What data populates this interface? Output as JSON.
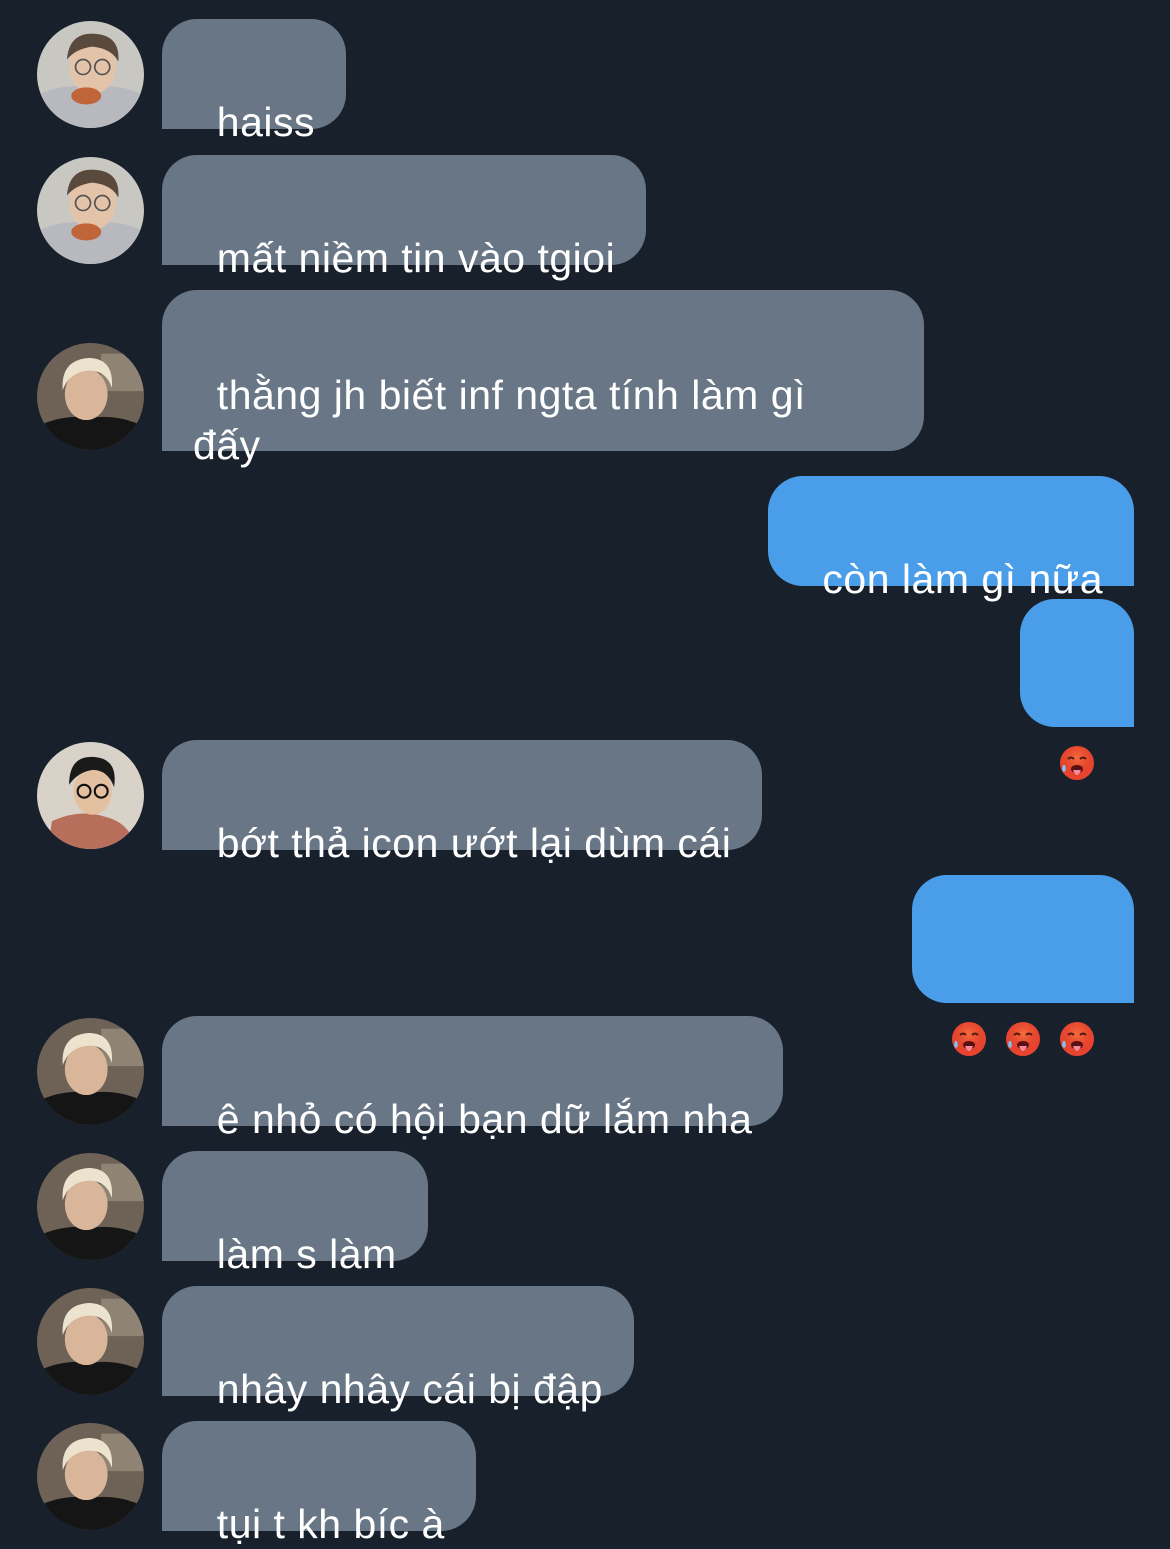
{
  "messages": [
    {
      "side": "in",
      "avatar": "glasses-boy-avatar",
      "text": "haiss"
    },
    {
      "side": "in",
      "avatar": "glasses-boy-avatar",
      "text": "mất niềm tin vào tgioi"
    },
    {
      "side": "in",
      "avatar": "blond-boy-avatar",
      "text": "thằng jh biết inf ngta tính làm gì\nđấy"
    },
    {
      "side": "out",
      "text": "còn làm gì nữa"
    },
    {
      "side": "out",
      "emoji": [
        "hot-face-emoji"
      ]
    },
    {
      "side": "in",
      "avatar": "dark-hair-boy-avatar",
      "text": "bớt thả icon ướt lại dùm cái"
    },
    {
      "side": "out",
      "emoji": [
        "hot-face-emoji",
        "hot-face-emoji",
        "hot-face-emoji"
      ]
    },
    {
      "side": "in",
      "avatar": "blond-boy-avatar",
      "text": "ê nhỏ có hội bạn dữ lắm nha"
    },
    {
      "side": "in",
      "avatar": "blond-boy-avatar",
      "text": "làm s làm"
    },
    {
      "side": "in",
      "avatar": "blond-boy-avatar",
      "text": "nhây nhây cái bị đập"
    },
    {
      "side": "in",
      "avatar": "blond-boy-avatar",
      "text": "tụi t kh bíc à"
    }
  ],
  "colors": {
    "background": "#18202b",
    "incoming_bubble": "#687685",
    "outgoing_bubble": "#4a9de8",
    "text": "#ffffff"
  }
}
